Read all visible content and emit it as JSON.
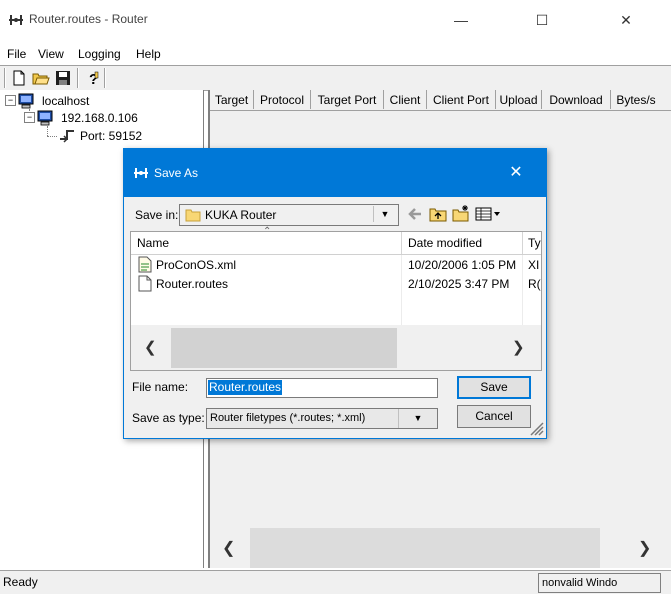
{
  "window": {
    "title": "Router.routes - Router",
    "minimize_glyph": "—",
    "maximize_glyph": "☐",
    "close_glyph": "✕"
  },
  "menu": [
    "File",
    "View",
    "Logging",
    "Help"
  ],
  "toolbar": {
    "icons": [
      "new-file-icon",
      "open-folder-icon",
      "save-icon",
      "help-icon"
    ]
  },
  "tree": {
    "root": "localhost",
    "child": "192.168.0.106",
    "port": "Port: 59152"
  },
  "columns": [
    "Target",
    "Protocol",
    "Target Port",
    "Client",
    "Client Port",
    "Upload",
    "Download",
    "Bytes/s"
  ],
  "status": {
    "text": "Ready",
    "right": "nonvalid Windo"
  },
  "dialog": {
    "title": "Save As",
    "save_in_label": "Save in:",
    "save_in_value": "KUKA Router",
    "list_headers": {
      "name": "Name",
      "date": "Date modified",
      "type": "Ty"
    },
    "files": [
      {
        "name": "ProConOS.xml",
        "date": "10/20/2006 1:05 PM",
        "type": "XI",
        "icon": "xml-file-icon"
      },
      {
        "name": "Router.routes",
        "date": "2/10/2025 3:47 PM",
        "type": "R(",
        "icon": "file-icon"
      }
    ],
    "file_name_label": "File name:",
    "file_name_value": "Router.routes",
    "save_as_type_label": "Save as type:",
    "save_as_type_value": "Router filetypes (*.routes; *.xml)",
    "save_button": "Save",
    "cancel_button": "Cancel"
  },
  "colors": {
    "accent": "#0078d7",
    "chrome": "#f0f0f0"
  }
}
